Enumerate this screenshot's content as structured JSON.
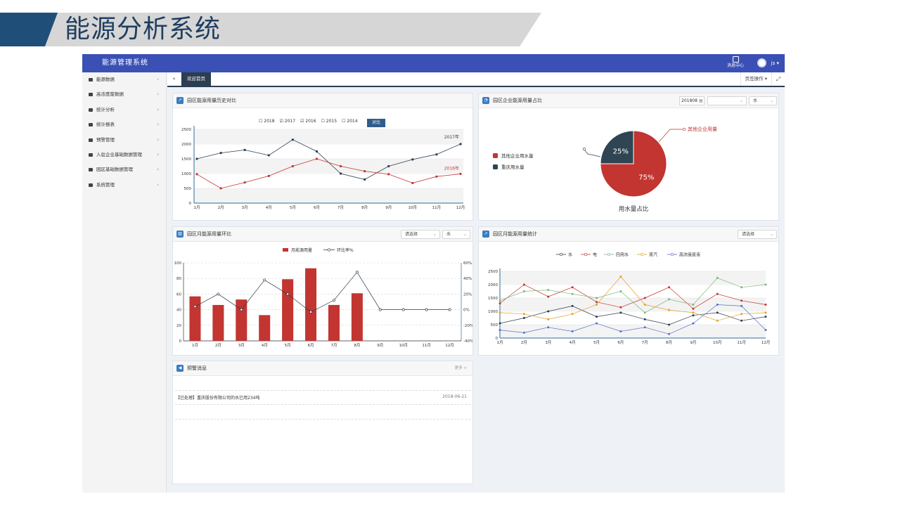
{
  "slide": {
    "title": "能源分析系统"
  },
  "app": {
    "brand": "能源管理系统",
    "message_center": "消息中心",
    "user_label": "js ▾"
  },
  "sidebar": {
    "items": [
      {
        "label": "能源数据",
        "icon": "car-icon"
      },
      {
        "label": "高浓度废数据",
        "icon": "flask-icon"
      },
      {
        "label": "统计分析",
        "icon": "chart-icon"
      },
      {
        "label": "统计报表",
        "icon": "table-icon"
      },
      {
        "label": "预警管理",
        "icon": "bell-icon"
      },
      {
        "label": "入驻企业基础数据管理",
        "icon": "map-icon"
      },
      {
        "label": "园区基础数据管理",
        "icon": "building-icon"
      },
      {
        "label": "系统管理",
        "icon": "monitor-icon"
      }
    ],
    "arrow": "‹"
  },
  "tabs": {
    "back_icon": "«",
    "active": "欢迎首页",
    "ops": "页签操作 ▾",
    "fullscreen": "⤢"
  },
  "panel_history": {
    "title": "园区能源用量历史对比",
    "year_options": [
      {
        "label": "2018",
        "checked": false
      },
      {
        "label": "2017",
        "checked": true
      },
      {
        "label": "2016",
        "checked": true
      },
      {
        "label": "2015",
        "checked": false
      },
      {
        "label": "2014",
        "checked": false
      }
    ],
    "compare_button": "对比"
  },
  "panel_pie": {
    "title": "园区企业能源用量占比",
    "date_value": "201808",
    "select1": "",
    "select2": "水"
  },
  "panel_monthly": {
    "title": "园区月能源用量环比",
    "select1": "请选择",
    "select2": "水"
  },
  "panel_stats": {
    "title": "园区月能源用量统计",
    "select1": "请选择"
  },
  "panel_warn": {
    "title": "预警消息",
    "more": "更多 >",
    "rows": [
      {
        "text": "【已处理】重庆股份有限公司的水已用234吨",
        "date": "2018-06-21"
      }
    ]
  },
  "chart_data": [
    {
      "type": "line",
      "categories": [
        "1月",
        "2月",
        "3月",
        "4月",
        "5月",
        "6月",
        "7月",
        "8月",
        "9月",
        "10月",
        "11月",
        "12月"
      ],
      "series": [
        {
          "name": "2017年",
          "color": "#2c3e50",
          "values": [
            1500,
            1700,
            1800,
            1620,
            2150,
            1750,
            1000,
            800,
            1250,
            1480,
            1650,
            2000
          ]
        },
        {
          "name": "2016年",
          "color": "#c23531",
          "values": [
            980,
            500,
            700,
            920,
            1250,
            1500,
            1250,
            1080,
            980,
            680,
            900,
            990
          ]
        }
      ],
      "ylim": [
        0,
        2500
      ],
      "yticks": [
        0,
        500,
        1000,
        1500,
        2000,
        2500
      ],
      "grid": true
    },
    {
      "type": "pie",
      "title": "用水量占比",
      "slices": [
        {
          "name": "其他企业用量",
          "value": 75,
          "label": "75%",
          "color": "#c23531"
        },
        {
          "name": "重庆用水量",
          "value": 25,
          "label": "25%",
          "color": "#2f4554"
        }
      ],
      "legend": [
        "其他企业用水量",
        "重庆用水量"
      ],
      "legend_position": "left"
    },
    {
      "type": "bar",
      "categories": [
        "1月",
        "2月",
        "3月",
        "4月",
        "5月",
        "6月",
        "7月",
        "8月",
        "9月",
        "10月",
        "11月",
        "12月"
      ],
      "series": [
        {
          "name": "月能源用量",
          "color": "#c23531",
          "values": [
            57,
            46,
            53,
            33,
            79,
            93,
            46,
            61,
            0,
            0,
            0,
            0
          ]
        },
        {
          "name": "环比率%",
          "color": "#2c3e50",
          "type": "line",
          "values": [
            4,
            20,
            0,
            38,
            20,
            -3,
            12,
            48,
            0,
            0,
            0,
            0
          ]
        }
      ],
      "ylim": [
        0,
        100
      ],
      "yticks": [
        0,
        20,
        40,
        60,
        80,
        100
      ],
      "y2lim": [
        -40,
        60
      ],
      "y2ticks": [
        "-40%",
        "-20%",
        "0%",
        "20%",
        "40%",
        "60%"
      ],
      "legend_position": "top"
    },
    {
      "type": "line",
      "categories": [
        "1月",
        "2月",
        "3月",
        "4月",
        "5月",
        "6月",
        "7月",
        "8月",
        "9月",
        "10月",
        "11月",
        "12月"
      ],
      "series": [
        {
          "name": "水",
          "color": "#2c3e50",
          "values": [
            550,
            750,
            1000,
            1200,
            800,
            950,
            700,
            500,
            850,
            950,
            650,
            800
          ]
        },
        {
          "name": "电",
          "color": "#c23531",
          "values": [
            1300,
            2000,
            1550,
            1900,
            1350,
            1150,
            1500,
            1900,
            1100,
            1650,
            1400,
            1250
          ]
        },
        {
          "name": "回用水",
          "color": "#7cb87c",
          "values": [
            1400,
            1750,
            1800,
            1650,
            1500,
            1750,
            950,
            1450,
            1250,
            2250,
            1900,
            2000
          ]
        },
        {
          "name": "蒸汽",
          "color": "#e5a128",
          "values": [
            950,
            900,
            700,
            900,
            1250,
            2300,
            1250,
            1050,
            950,
            650,
            900,
            950
          ]
        },
        {
          "name": "高浓度废液",
          "color": "#5470c6",
          "values": [
            300,
            200,
            400,
            250,
            550,
            250,
            400,
            150,
            550,
            1250,
            1200,
            300
          ]
        }
      ],
      "ylim": [
        0,
        2500
      ],
      "yticks": [
        0,
        500,
        1000,
        1500,
        2000,
        2500
      ],
      "legend_position": "top"
    }
  ]
}
